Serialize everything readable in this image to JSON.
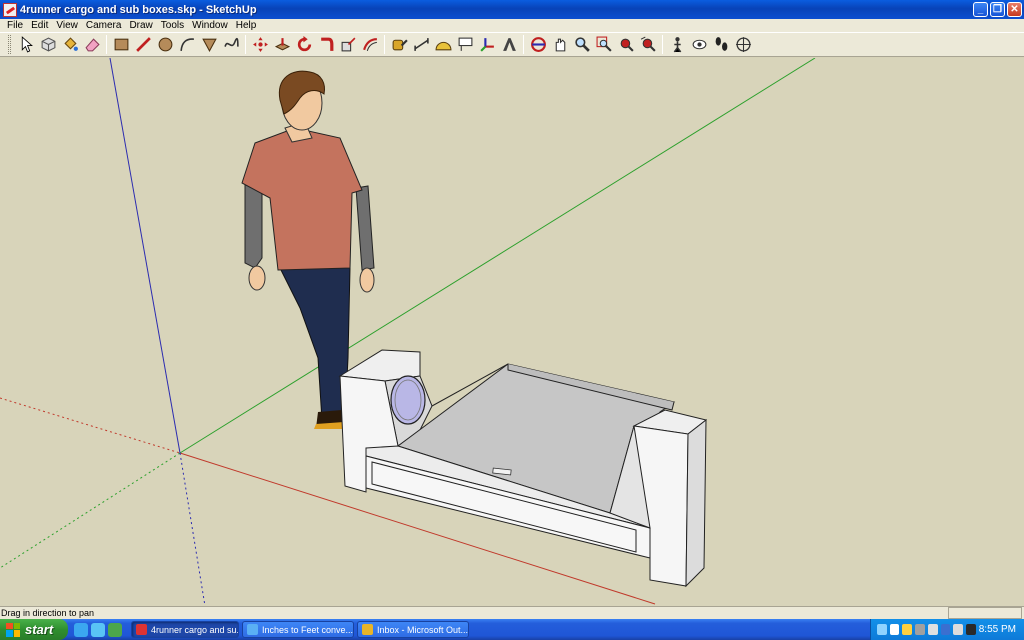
{
  "window": {
    "title": "4runner cargo and sub boxes.skp - SketchUp",
    "buttons": [
      "_",
      "❐",
      "✕"
    ]
  },
  "menu": [
    "File",
    "Edit",
    "View",
    "Camera",
    "Draw",
    "Tools",
    "Window",
    "Help"
  ],
  "toolbar": {
    "tools": [
      "select-icon",
      "component-icon",
      "paint-bucket-icon",
      "eraser-icon",
      "rectangle-icon",
      "line-icon",
      "circle-icon",
      "arc-icon",
      "polygon-icon",
      "freehand-icon",
      "move-icon",
      "push-pull-icon",
      "rotate-icon",
      "follow-me-icon",
      "scale-icon",
      "offset-icon",
      "tape-measure-icon",
      "dimension-icon",
      "protractor-icon",
      "text-icon",
      "axes-icon",
      "3d-text-icon",
      "orbit-icon",
      "pan-icon",
      "zoom-icon",
      "zoom-window-icon",
      "zoom-extents-icon",
      "previous-view-icon",
      "position-camera-icon",
      "look-around-icon",
      "walk-icon",
      "section-plane-icon"
    ]
  },
  "status": {
    "message": "Drag in direction to pan",
    "measurements": ""
  },
  "taskbar": {
    "start_label": "start",
    "items": [
      {
        "label": "4runner cargo and su...",
        "active": true
      },
      {
        "label": "Inches to Feet conve...",
        "active": false
      },
      {
        "label": "Inbox - Microsoft Out...",
        "active": false
      }
    ],
    "clock": "8:55 PM"
  },
  "colors": {
    "viewport_bg": "#d8d4ba",
    "axis_red": "#c0392b",
    "axis_green": "#2ca02c",
    "axis_blue": "#2b2bb0",
    "model_face": "#f4f4f4",
    "model_top": "#c4c4c4"
  }
}
